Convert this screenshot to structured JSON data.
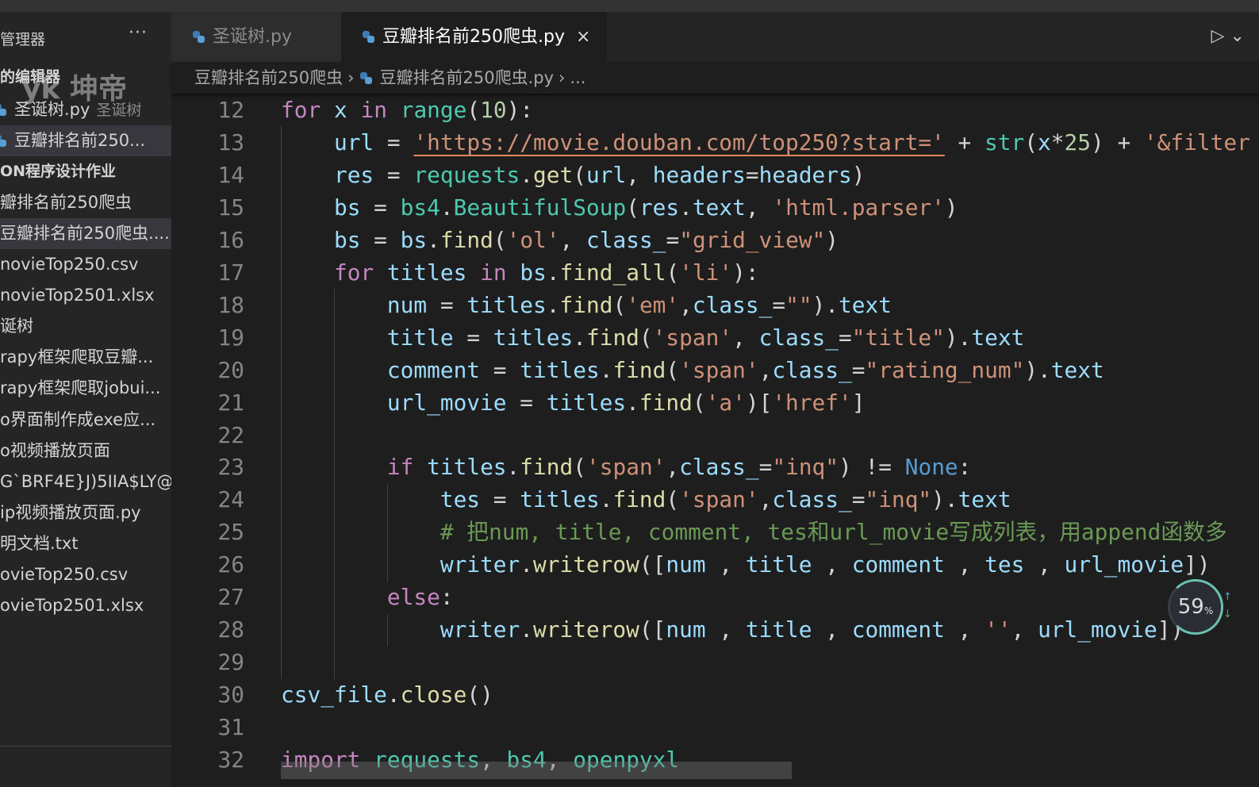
{
  "sidebar": {
    "header": "管理器",
    "more_icon": "ellipsis-icon",
    "watermark": "yk 坤帝",
    "items": [
      {
        "label": "的编辑器",
        "bold": true
      },
      {
        "label": "圣诞树.py",
        "desc": "圣诞树",
        "icon": "python"
      },
      {
        "label": "豆瓣排名前250...",
        "icon": "python",
        "selected": true
      },
      {
        "label": "ON程序设计作业",
        "bold": true
      },
      {
        "label": "瓣排名前250爬虫"
      },
      {
        "label": "豆瓣排名前250爬虫....",
        "selected": true
      },
      {
        "label": "novieTop250.csv"
      },
      {
        "label": "novieTop2501.xlsx"
      },
      {
        "label": "诞树"
      },
      {
        "label": "rapy框架爬取豆瓣..."
      },
      {
        "label": "rapy框架爬取jobui..."
      },
      {
        "label": "o界面制作成exe应..."
      },
      {
        "label": "o视频播放页面"
      },
      {
        "label": "G`BRF4E}J)5IIA$LY@..."
      },
      {
        "label": "ip视频播放页面.py"
      },
      {
        "label": "明文档.txt"
      },
      {
        "label": "ovieTop250.csv"
      },
      {
        "label": "ovieTop2501.xlsx"
      }
    ]
  },
  "tabs": [
    {
      "label": "圣诞树.py",
      "active": false
    },
    {
      "label": "豆瓣排名前250爬虫.py",
      "active": true,
      "close": "×"
    }
  ],
  "breadcrumb": {
    "folder": "豆瓣排名前250爬虫",
    "file": "豆瓣排名前250爬虫.py",
    "more": "..."
  },
  "editor": {
    "lines": [
      {
        "n": "12",
        "t": [
          [
            "k",
            "for"
          ],
          [
            "p",
            " "
          ],
          [
            "v",
            "x"
          ],
          [
            "p",
            " "
          ],
          [
            "k",
            "in"
          ],
          [
            "p",
            " "
          ],
          [
            "c",
            "range"
          ],
          [
            "p",
            "("
          ],
          [
            "n",
            "10"
          ],
          [
            "p",
            "):"
          ]
        ]
      },
      {
        "n": "13",
        "t": [
          [
            "p",
            "    "
          ],
          [
            "v",
            "url"
          ],
          [
            "p",
            " = "
          ],
          [
            "s",
            "'https://movie.douban.com/top250?start='"
          ],
          [
            "p",
            " + "
          ],
          [
            "c",
            "str"
          ],
          [
            "p",
            "("
          ],
          [
            "v",
            "x"
          ],
          [
            "p",
            "*"
          ],
          [
            "n",
            "25"
          ],
          [
            "p",
            ") + "
          ],
          [
            "s",
            "'&filter"
          ]
        ]
      },
      {
        "n": "14",
        "t": [
          [
            "p",
            "    "
          ],
          [
            "v",
            "res"
          ],
          [
            "p",
            " = "
          ],
          [
            "c",
            "requests"
          ],
          [
            "p",
            "."
          ],
          [
            "f",
            "get"
          ],
          [
            "p",
            "("
          ],
          [
            "v",
            "url"
          ],
          [
            "p",
            ", "
          ],
          [
            "v",
            "headers"
          ],
          [
            "p",
            "="
          ],
          [
            "v",
            "headers"
          ],
          [
            "p",
            ")"
          ]
        ]
      },
      {
        "n": "15",
        "t": [
          [
            "p",
            "    "
          ],
          [
            "v",
            "bs"
          ],
          [
            "p",
            " = "
          ],
          [
            "c",
            "bs4"
          ],
          [
            "p",
            "."
          ],
          [
            "c",
            "BeautifulSoup"
          ],
          [
            "p",
            "("
          ],
          [
            "v",
            "res"
          ],
          [
            "p",
            "."
          ],
          [
            "v",
            "text"
          ],
          [
            "p",
            ", "
          ],
          [
            "s",
            "'html.parser'"
          ],
          [
            "p",
            ")"
          ]
        ]
      },
      {
        "n": "16",
        "t": [
          [
            "p",
            "    "
          ],
          [
            "v",
            "bs"
          ],
          [
            "p",
            " = "
          ],
          [
            "v",
            "bs"
          ],
          [
            "p",
            "."
          ],
          [
            "f",
            "find"
          ],
          [
            "p",
            "("
          ],
          [
            "s",
            "'ol'"
          ],
          [
            "p",
            ", "
          ],
          [
            "v",
            "class_"
          ],
          [
            "p",
            "="
          ],
          [
            "s",
            "\"grid_view\""
          ],
          [
            "p",
            ")"
          ]
        ]
      },
      {
        "n": "17",
        "t": [
          [
            "p",
            "    "
          ],
          [
            "k",
            "for"
          ],
          [
            "p",
            " "
          ],
          [
            "v",
            "titles"
          ],
          [
            "p",
            " "
          ],
          [
            "k",
            "in"
          ],
          [
            "p",
            " "
          ],
          [
            "v",
            "bs"
          ],
          [
            "p",
            "."
          ],
          [
            "f",
            "find_all"
          ],
          [
            "p",
            "("
          ],
          [
            "s",
            "'li'"
          ],
          [
            "p",
            "):"
          ]
        ]
      },
      {
        "n": "18",
        "t": [
          [
            "p",
            "        "
          ],
          [
            "v",
            "num"
          ],
          [
            "p",
            " = "
          ],
          [
            "v",
            "titles"
          ],
          [
            "p",
            "."
          ],
          [
            "f",
            "find"
          ],
          [
            "p",
            "("
          ],
          [
            "s",
            "'em'"
          ],
          [
            "p",
            ","
          ],
          [
            "v",
            "class_"
          ],
          [
            "p",
            "="
          ],
          [
            "s",
            "\"\""
          ],
          [
            "p",
            ")."
          ],
          [
            "v",
            "text"
          ]
        ]
      },
      {
        "n": "19",
        "t": [
          [
            "p",
            "        "
          ],
          [
            "v",
            "title"
          ],
          [
            "p",
            " = "
          ],
          [
            "v",
            "titles"
          ],
          [
            "p",
            "."
          ],
          [
            "f",
            "find"
          ],
          [
            "p",
            "("
          ],
          [
            "s",
            "'span'"
          ],
          [
            "p",
            ", "
          ],
          [
            "v",
            "class_"
          ],
          [
            "p",
            "="
          ],
          [
            "s",
            "\"title\""
          ],
          [
            "p",
            ")."
          ],
          [
            "v",
            "text"
          ]
        ]
      },
      {
        "n": "20",
        "t": [
          [
            "p",
            "        "
          ],
          [
            "v",
            "comment"
          ],
          [
            "p",
            " = "
          ],
          [
            "v",
            "titles"
          ],
          [
            "p",
            "."
          ],
          [
            "f",
            "find"
          ],
          [
            "p",
            "("
          ],
          [
            "s",
            "'span'"
          ],
          [
            "p",
            ","
          ],
          [
            "v",
            "class_"
          ],
          [
            "p",
            "="
          ],
          [
            "s",
            "\"rating_num\""
          ],
          [
            "p",
            ")."
          ],
          [
            "v",
            "text"
          ]
        ]
      },
      {
        "n": "21",
        "t": [
          [
            "p",
            "        "
          ],
          [
            "v",
            "url_movie"
          ],
          [
            "p",
            " = "
          ],
          [
            "v",
            "titles"
          ],
          [
            "p",
            "."
          ],
          [
            "f",
            "find"
          ],
          [
            "p",
            "("
          ],
          [
            "s",
            "'a'"
          ],
          [
            "p",
            ")["
          ],
          [
            "s",
            "'href'"
          ],
          [
            "p",
            "]"
          ]
        ]
      },
      {
        "n": "22",
        "t": []
      },
      {
        "n": "23",
        "t": [
          [
            "p",
            "        "
          ],
          [
            "k",
            "if"
          ],
          [
            "p",
            " "
          ],
          [
            "v",
            "titles"
          ],
          [
            "p",
            "."
          ],
          [
            "f",
            "find"
          ],
          [
            "p",
            "("
          ],
          [
            "s",
            "'span'"
          ],
          [
            "p",
            ","
          ],
          [
            "v",
            "class_"
          ],
          [
            "p",
            "="
          ],
          [
            "s",
            "\"inq\""
          ],
          [
            "p",
            ") != "
          ],
          [
            "b",
            "None"
          ],
          [
            "p",
            ":"
          ]
        ]
      },
      {
        "n": "24",
        "t": [
          [
            "p",
            "            "
          ],
          [
            "v",
            "tes"
          ],
          [
            "p",
            " = "
          ],
          [
            "v",
            "titles"
          ],
          [
            "p",
            "."
          ],
          [
            "f",
            "find"
          ],
          [
            "p",
            "("
          ],
          [
            "s",
            "'span'"
          ],
          [
            "p",
            ","
          ],
          [
            "v",
            "class_"
          ],
          [
            "p",
            "="
          ],
          [
            "s",
            "\"inq\""
          ],
          [
            "p",
            ")."
          ],
          [
            "v",
            "text"
          ]
        ]
      },
      {
        "n": "25",
        "t": [
          [
            "p",
            "            "
          ],
          [
            "m",
            "# 把num, title, comment, tes和url_movie写成列表，用append函数多"
          ]
        ]
      },
      {
        "n": "26",
        "t": [
          [
            "p",
            "            "
          ],
          [
            "v",
            "writer"
          ],
          [
            "p",
            "."
          ],
          [
            "f",
            "writerow"
          ],
          [
            "p",
            "(["
          ],
          [
            "v",
            "num"
          ],
          [
            "p",
            " , "
          ],
          [
            "v",
            "title"
          ],
          [
            "p",
            " , "
          ],
          [
            "v",
            "comment"
          ],
          [
            "p",
            " , "
          ],
          [
            "v",
            "tes"
          ],
          [
            "p",
            " , "
          ],
          [
            "v",
            "url_movie"
          ],
          [
            "p",
            "])"
          ]
        ]
      },
      {
        "n": "27",
        "t": [
          [
            "p",
            "        "
          ],
          [
            "k",
            "else"
          ],
          [
            "p",
            ":"
          ]
        ]
      },
      {
        "n": "28",
        "t": [
          [
            "p",
            "            "
          ],
          [
            "v",
            "writer"
          ],
          [
            "p",
            "."
          ],
          [
            "f",
            "writerow"
          ],
          [
            "p",
            "(["
          ],
          [
            "v",
            "num"
          ],
          [
            "p",
            " , "
          ],
          [
            "v",
            "title"
          ],
          [
            "p",
            " , "
          ],
          [
            "v",
            "comment"
          ],
          [
            "p",
            " , "
          ],
          [
            "s",
            "''"
          ],
          [
            "p",
            ", "
          ],
          [
            "v",
            "url_movie"
          ],
          [
            "p",
            "])"
          ]
        ]
      },
      {
        "n": "29",
        "t": []
      },
      {
        "n": "30",
        "t": [
          [
            "v",
            "csv_file"
          ],
          [
            "p",
            "."
          ],
          [
            "f",
            "close"
          ],
          [
            "p",
            "()"
          ]
        ]
      },
      {
        "n": "31",
        "t": []
      },
      {
        "n": "32",
        "t": [
          [
            "k",
            "import"
          ],
          [
            "p",
            " "
          ],
          [
            "c",
            "requests"
          ],
          [
            "p",
            ", "
          ],
          [
            "c",
            "bs4"
          ],
          [
            "p",
            ", "
          ],
          [
            "c",
            "openpyxl"
          ]
        ]
      }
    ]
  },
  "overlay": {
    "percent": "59",
    "percent_sign": "%"
  },
  "colors": {
    "keyword": "#c586c0",
    "variable": "#9cdcfe",
    "function": "#dcdcaa",
    "string": "#ce9178",
    "number": "#b5cea8",
    "class": "#4ec9b0",
    "comment": "#6a9955",
    "constant": "#569cd6"
  }
}
